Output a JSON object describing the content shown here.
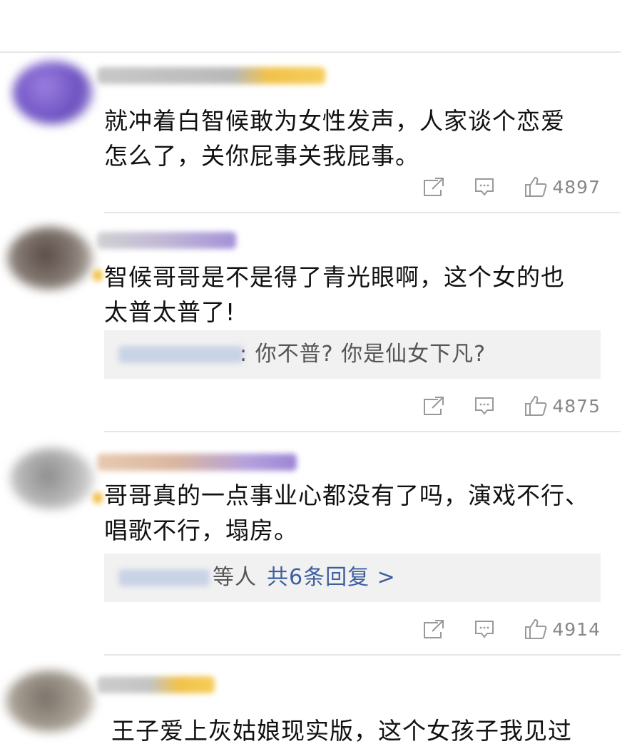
{
  "comments": [
    {
      "text_line1": "就冲着白智候敢为女性发声，人家谈个恋爱",
      "text_line2": "怎么了，关你屁事关我屁事。",
      "likes": "4897"
    },
    {
      "text_line1": "智候哥哥是不是得了青光眼啊，这个女的也",
      "text_line2": "太普太普了!",
      "reply_text": ": 你不普? 你是仙女下凡?",
      "likes": "4875"
    },
    {
      "text_line1": "哥哥真的一点事业心都没有了吗，演戏不行、",
      "text_line2": "唱歌不行，塌房。",
      "reply_suffix": "等人",
      "reply_more": "共6条回复 >",
      "likes": "4914"
    },
    {
      "text_line1": "王子爱上灰姑娘现实版，这个女孩子我见过"
    }
  ],
  "icons": {
    "share": "share-icon",
    "comment": "comment-icon",
    "like": "thumbs-up-icon"
  },
  "colors": {
    "text": "#111111",
    "muted": "#888888",
    "link": "#3d5f9e",
    "reply_bg": "#f1f1f1"
  }
}
